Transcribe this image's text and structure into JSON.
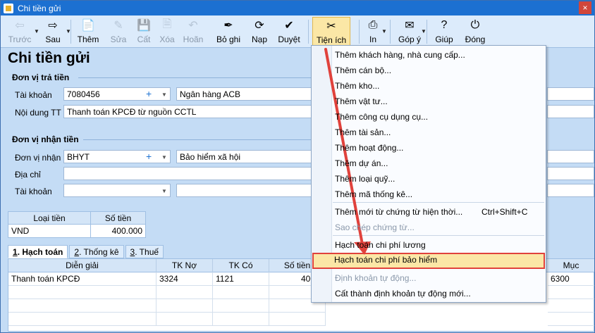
{
  "window": {
    "title": "Chi tiền gửi",
    "close_glyph": "×"
  },
  "toolbar": {
    "items": [
      {
        "label": "Trước",
        "icon": "arrow-left-icon",
        "glyph": "⇦",
        "disabled": true
      },
      {
        "label": "Sau",
        "icon": "arrow-right-icon",
        "glyph": "⇨",
        "disabled": false
      },
      {
        "label": "Thêm",
        "icon": "new-document-icon",
        "glyph": "📄",
        "disabled": false
      },
      {
        "label": "Sửa",
        "icon": "edit-icon",
        "glyph": "✎",
        "disabled": true
      },
      {
        "label": "Cất",
        "icon": "save-icon",
        "glyph": "💾",
        "disabled": true
      },
      {
        "label": "Xóa",
        "icon": "delete-icon",
        "glyph": "🗎",
        "disabled": true
      },
      {
        "label": "Hoãn",
        "icon": "undo-icon",
        "glyph": "↶",
        "disabled": true
      },
      {
        "label": "Bỏ ghi",
        "icon": "unpost-icon",
        "glyph": "✒",
        "disabled": false
      },
      {
        "label": "Nạp",
        "icon": "reload-icon",
        "glyph": "⟳",
        "disabled": false
      },
      {
        "label": "Duyệt",
        "icon": "check-icon",
        "glyph": "✔",
        "disabled": false
      },
      {
        "label": "Tiện ích",
        "icon": "tools-icon",
        "glyph": "✂",
        "disabled": false
      },
      {
        "label": "In",
        "icon": "printer-icon",
        "glyph": "⎙",
        "disabled": false
      },
      {
        "label": "Góp ý",
        "icon": "feedback-icon",
        "glyph": "✉",
        "disabled": false
      },
      {
        "label": "Giúp",
        "icon": "help-icon",
        "glyph": "?",
        "disabled": false
      },
      {
        "label": "Đóng",
        "icon": "close-icon",
        "glyph": "⏻",
        "disabled": false
      }
    ],
    "dropdown_glyph": "▼"
  },
  "page_title": "Chi tiền gửi",
  "payer": {
    "group_title": "Đơn vị trả tiền",
    "account_label": "Tài khoản",
    "account_value": "7080456",
    "bank_name": "Ngân hàng ACB",
    "content_label": "Nội dung TT",
    "content_value": "Thanh toán KPCĐ từ nguồn CCTL"
  },
  "payee": {
    "group_title": "Đơn vị nhận tiền",
    "unit_label": "Đơn vị nhận",
    "unit_code": "BHYT",
    "unit_name": "Bảo hiểm xã hội",
    "address_label": "Địa chỉ",
    "address_value": "",
    "account_label": "Tài khoản",
    "account_value": ""
  },
  "currency_table": {
    "headers": [
      "Loại tiền",
      "Số tiền"
    ],
    "row": [
      "VND",
      "400.000"
    ]
  },
  "tabs": [
    {
      "key": "1",
      "label": ". Hạch toán",
      "active": true
    },
    {
      "key": "2",
      "label": ". Thống kê",
      "active": false
    },
    {
      "key": "3",
      "label": ". Thuế",
      "active": false
    }
  ],
  "grid": {
    "headers": [
      "Diễn giải",
      "TK Nợ",
      "TK Có",
      "Số tiền",
      "Mục"
    ],
    "rows": [
      [
        "Thanh toán KPCĐ",
        "3324",
        "1121",
        "400.0",
        "6300"
      ]
    ]
  },
  "menu": {
    "items": [
      {
        "label": "Thêm khách hàng, nhà cung cấp...",
        "shortcut": "",
        "disabled": false
      },
      {
        "label": "Thêm cán bộ...",
        "shortcut": "",
        "disabled": false
      },
      {
        "label": "Thêm kho...",
        "shortcut": "",
        "disabled": false
      },
      {
        "label": "Thêm vật tư...",
        "shortcut": "",
        "disabled": false
      },
      {
        "label": "Thêm công cụ dụng cụ...",
        "shortcut": "",
        "disabled": false
      },
      {
        "label": "Thêm tài sản...",
        "shortcut": "",
        "disabled": false
      },
      {
        "label": "Thêm hoạt động...",
        "shortcut": "",
        "disabled": false
      },
      {
        "label": "Thêm dự án...",
        "shortcut": "",
        "disabled": false
      },
      {
        "label": "Thêm loại quỹ...",
        "shortcut": "",
        "disabled": false
      },
      {
        "label": "Thêm mã thống kê...",
        "shortcut": "",
        "disabled": false
      },
      {
        "label": "Thêm mới từ chứng từ hiện thời...",
        "shortcut": "Ctrl+Shift+C",
        "disabled": false
      },
      {
        "label": "Sao chép chứng từ...",
        "shortcut": "",
        "disabled": true
      },
      {
        "label": "Hạch toán chi phí lương",
        "shortcut": "",
        "disabled": false
      },
      {
        "label": "Hạch toán chi phí bảo hiểm",
        "shortcut": "",
        "disabled": false,
        "highlighted": true
      },
      {
        "label": "Định khoản tự động...",
        "shortcut": "",
        "disabled": true
      },
      {
        "label": "Cất thành định khoản tự động mới...",
        "shortcut": "",
        "disabled": false
      }
    ]
  },
  "colors": {
    "titlebar": "#1c70d1",
    "panel": "#c4dcf5",
    "highlight_border": "#e0423c",
    "highlight_fill": "#fbe7a6",
    "plus": "#1f73d2"
  }
}
